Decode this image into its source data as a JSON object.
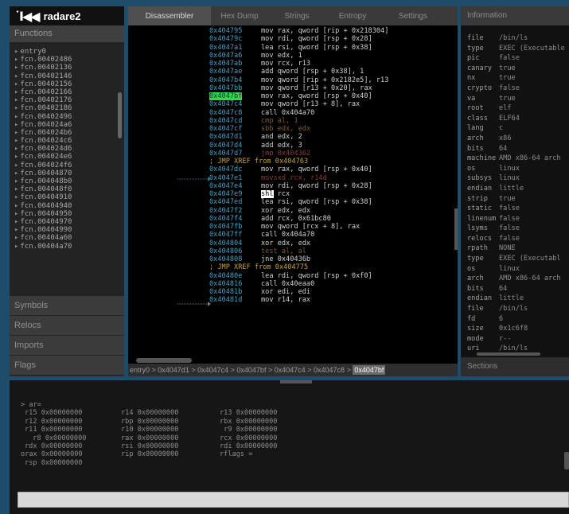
{
  "app": {
    "title": "radare2",
    "logo_mark": "˙I◀◀"
  },
  "sidebar": {
    "functions_title": "Functions",
    "functions": [
      "entry0",
      "fcn.00402486",
      "fcn.00402136",
      "fcn.00402146",
      "fcn.00402156",
      "fcn.00402166",
      "fcn.00402176",
      "fcn.00402186",
      "fcn.00402496",
      "fcn.004024a6",
      "fcn.004024b6",
      "fcn.004024c6",
      "fcn.004024d6",
      "fcn.004024e6",
      "fcn.004024f6",
      "fcn.00404870",
      "fcn.004048b0",
      "fcn.004048f0",
      "fcn.00404910",
      "fcn.00404940",
      "fcn.00404950",
      "fcn.00404970",
      "fcn.00404990",
      "fcn.00404a60",
      "fcn.00404a70"
    ],
    "sections": [
      "Symbols",
      "Relocs",
      "Imports",
      "Flags"
    ]
  },
  "tabs": [
    "Disassembler",
    "Hex Dump",
    "Strings",
    "Entropy",
    "Settings"
  ],
  "active_tab": "Disassembler",
  "disasm": [
    {
      "addr": "0x404795",
      "ins": "mov rax, qword [rip + 0x218304]"
    },
    {
      "addr": "0x40479c",
      "ins": "mov rdi, qword [rsp + 0x28]"
    },
    {
      "addr": "0x4047a1",
      "ins": "lea rsi, qword [rsp + 0x38]"
    },
    {
      "addr": "0x4047a6",
      "ins": "mov edx, 1"
    },
    {
      "addr": "0x4047ab",
      "ins": "mov rcx, r13"
    },
    {
      "addr": "0x4047ae",
      "ins": "add qword [rsp + 0x38], 1"
    },
    {
      "addr": "0x4047b4",
      "ins": "mov qword [rip + 0x2182e5], r13"
    },
    {
      "addr": "0x4047bb",
      "ins": "mov qword [r13 + 0x20], rax"
    },
    {
      "addr": "0x4047bf",
      "ins": "mov rax, qword [rsp + 0x40]",
      "hl": true
    },
    {
      "addr": "0x4047c4",
      "ins": "mov qword [r13 + 8], rax"
    },
    {
      "addr": "0x4047c8",
      "ins": "call 0x404a70"
    },
    {
      "addr": "0x4047cd",
      "ins": "cmp al, 1",
      "style": "dim"
    },
    {
      "addr": "0x4047cf",
      "ins": "sbb edx, edx",
      "style": "dim"
    },
    {
      "addr": "0x4047d1",
      "ins": "and edx, 2"
    },
    {
      "addr": "0x4047d4",
      "ins": "add edx, 3"
    },
    {
      "addr": "0x4047d7",
      "ins": "jmp 0x404362",
      "style": "red"
    },
    {
      "xref": "; JMP XREF from 0x404763"
    },
    {
      "addr": "0x4047dc",
      "ins": "mov rax, qword [rsp + 0x40]"
    },
    {
      "addr": "0x4047e1",
      "ins": "movsxd rcx, r14d",
      "style": "red"
    },
    {
      "addr": "0x4047e4",
      "ins": "mov rdi, qword [rsp + 0x28]"
    },
    {
      "addr": "0x4047e9",
      "ins": "shl rcx",
      "reg_hl": "shl"
    },
    {
      "addr": "0x4047ed",
      "ins": "lea rsi, qword [rsp + 0x38]"
    },
    {
      "addr": "0x4047f2",
      "ins": "xor edx, edx"
    },
    {
      "addr": "0x4047f4",
      "ins": "add rcx, 0x61bc80"
    },
    {
      "addr": "0x4047fb",
      "ins": "mov qword [rcx + 8], rax"
    },
    {
      "addr": "0x4047ff",
      "ins": "call 0x404a70"
    },
    {
      "addr": "0x404804",
      "ins": "xor edx, edx"
    },
    {
      "addr": "0x404806",
      "ins": "test al, al",
      "style": "dim"
    },
    {
      "addr": "0x404808",
      "ins": "jne 0x40436b"
    },
    {
      "xref": "; JMP XREF from 0x404775"
    },
    {
      "addr": "0x40480e",
      "ins": "lea rdi, qword [rsp + 0xf0]"
    },
    {
      "addr": "0x404816",
      "ins": "call 0x40eaa0"
    },
    {
      "addr": "0x40481b",
      "ins": "xor edi, edi"
    },
    {
      "addr": "0x40481d",
      "ins": "mov r14, rax"
    }
  ],
  "breadcrumb": [
    "entry0",
    "0x4047d1",
    "0x4047c4",
    "0x4047bf",
    "0x4047c4",
    "0x4047c8",
    "0x4047bf"
  ],
  "info_panel": {
    "title": "Information",
    "sections_title": "Sections",
    "rows": [
      [
        "file",
        "/bin/ls"
      ],
      [
        "type",
        "EXEC (Executable"
      ],
      [
        "pic",
        "false"
      ],
      [
        "canary",
        "true"
      ],
      [
        "nx",
        "true"
      ],
      [
        "crypto",
        "false"
      ],
      [
        "va",
        "true"
      ],
      [
        "root",
        "elf"
      ],
      [
        "class",
        "ELF64"
      ],
      [
        "lang",
        "c"
      ],
      [
        "arch",
        "x86"
      ],
      [
        "bits",
        "64"
      ],
      [
        "machine",
        "AMD x86-64 arch"
      ],
      [
        "os",
        "linux"
      ],
      [
        "subsys",
        "linux"
      ],
      [
        "endian",
        "little"
      ],
      [
        "strip",
        "true"
      ],
      [
        "static",
        "false"
      ],
      [
        "linenum",
        "false"
      ],
      [
        "lsyms",
        "false"
      ],
      [
        "relocs",
        "false"
      ],
      [
        "rpath",
        "NONE"
      ],
      [
        "type",
        "EXEC (Executabl"
      ],
      [
        "os",
        "linux"
      ],
      [
        "arch",
        "AMD x86-64 arch"
      ],
      [
        "bits",
        "64"
      ],
      [
        "endian",
        "little"
      ],
      [
        "file",
        "/bin/ls"
      ],
      [
        "fd",
        "6"
      ],
      [
        "size",
        "0x1c6f8"
      ],
      [
        "mode",
        "r--"
      ],
      [
        "uri",
        "/bin/ls"
      ]
    ]
  },
  "terminal": {
    "prompt": "> ar=",
    "rows": [
      [
        "r15 0x00000000",
        "r14 0x00000000",
        "r13 0x00000000"
      ],
      [
        "r12 0x00000000",
        "rbp 0x00000000",
        "rbx 0x00000000"
      ],
      [
        "r11 0x00000000",
        "r10 0x00000000",
        " r9 0x00000000"
      ],
      [
        " r8 0x00000000",
        "rax 0x00000000",
        "rcx 0x00000000"
      ],
      [
        "rdx 0x00000000",
        "rsi 0x00000000",
        "rdi 0x00000000"
      ],
      [
        "orax 0x00000000",
        "rip 0x00000000",
        "rflags ="
      ],
      [
        "rsp 0x00000000",
        "",
        ""
      ]
    ],
    "input_value": ""
  }
}
